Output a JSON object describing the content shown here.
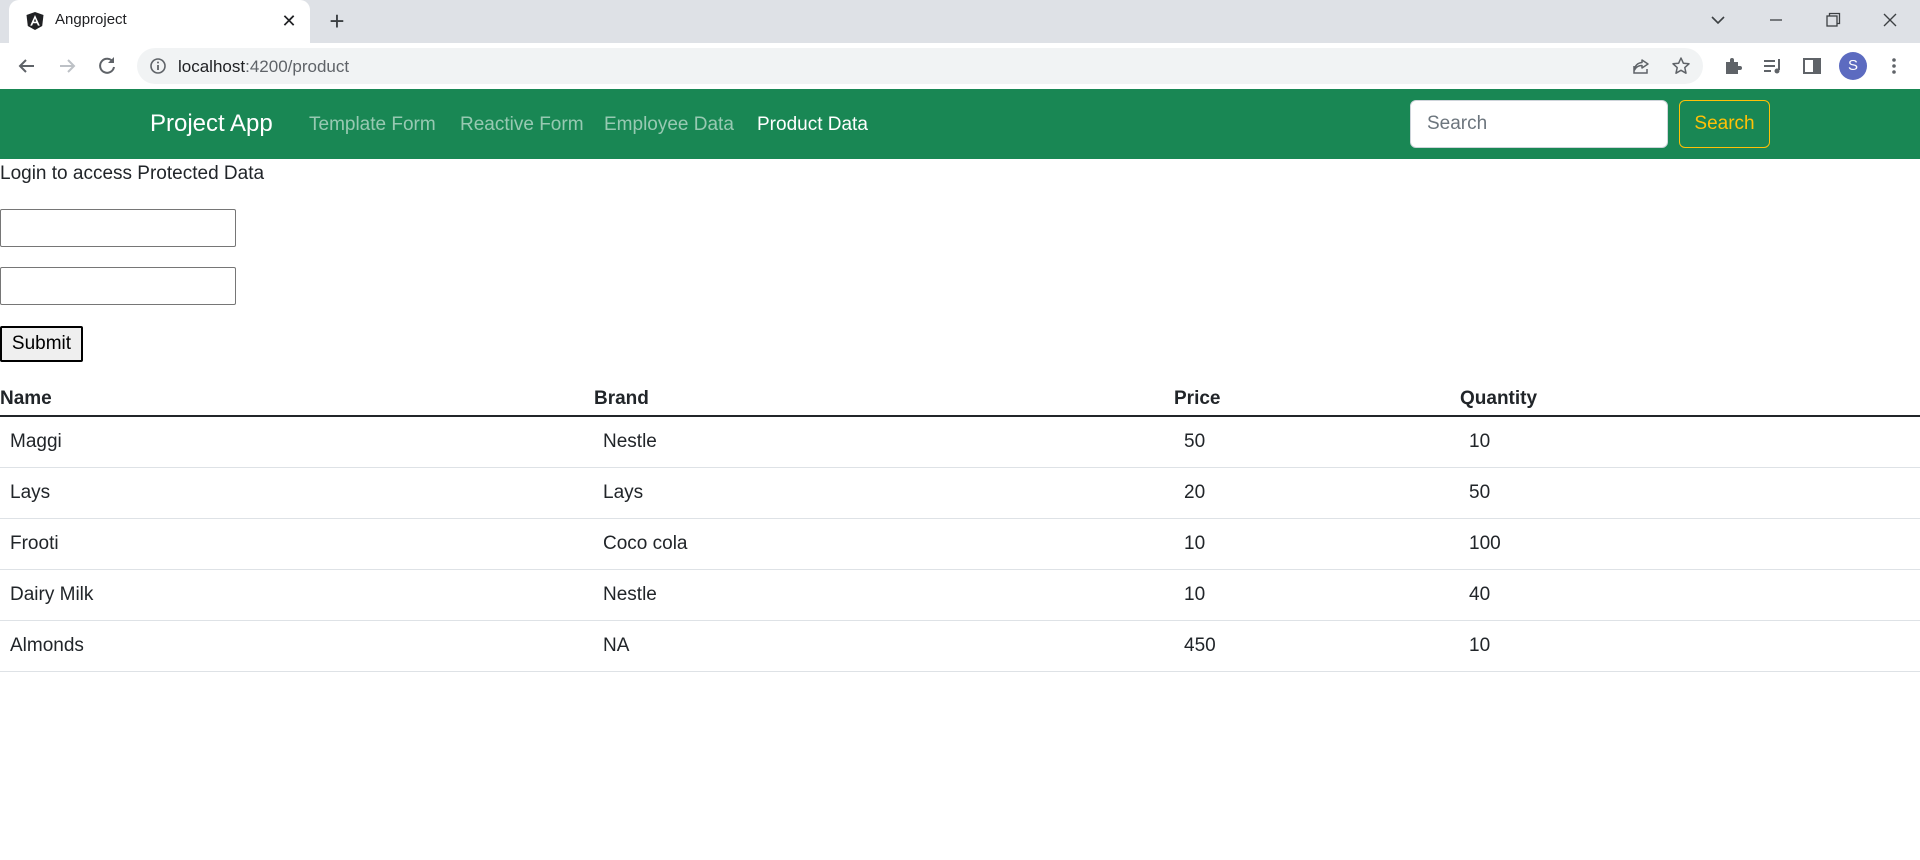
{
  "browser": {
    "tab_title": "Angproject",
    "new_tab_label": "+",
    "close_tab_label": "✕",
    "url_host": "localhost",
    "url_path": ":4200/product",
    "profile_initial": "S"
  },
  "navbar": {
    "brand": "Project App",
    "links": [
      {
        "label": "Template Form",
        "active": false
      },
      {
        "label": "Reactive Form",
        "active": false
      },
      {
        "label": "Employee Data",
        "active": false
      },
      {
        "label": "Product Data",
        "active": true
      }
    ],
    "search_placeholder": "Search",
    "search_button": "Search",
    "colors": {
      "bg": "#198754",
      "warning": "#ffc107"
    }
  },
  "login": {
    "heading": "Login to access Protected Data",
    "submit_label": "Submit"
  },
  "table": {
    "headers": [
      "Name",
      "Brand",
      "Price",
      "Quantity"
    ],
    "rows": [
      [
        "Maggi",
        "Nestle",
        "50",
        "10"
      ],
      [
        "Lays",
        "Lays",
        "20",
        "50"
      ],
      [
        "Frooti",
        "Coco cola",
        "10",
        "100"
      ],
      [
        "Dairy Milk",
        "Nestle",
        "10",
        "40"
      ],
      [
        "Almonds",
        "NA",
        "450",
        "10"
      ]
    ]
  }
}
